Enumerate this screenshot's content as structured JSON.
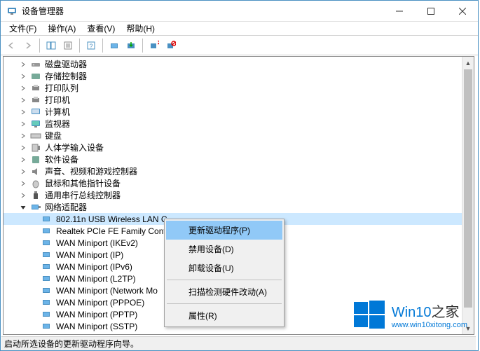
{
  "window": {
    "title": "设备管理器"
  },
  "menu": {
    "file": "文件(F)",
    "action": "操作(A)",
    "view": "查看(V)",
    "help": "帮助(H)"
  },
  "tree": {
    "disk_drives": "磁盘驱动器",
    "storage_controllers": "存储控制器",
    "print_queues": "打印队列",
    "printers": "打印机",
    "computer": "计算机",
    "monitors": "监视器",
    "keyboards": "键盘",
    "hid": "人体学输入设备",
    "software_devices": "软件设备",
    "sound": "声音、视频和游戏控制器",
    "mice": "鼠标和其他指针设备",
    "usb_controllers": "通用串行总线控制器",
    "network_adapters": "网络适配器",
    "na": {
      "n0": "802.11n USB Wireless LAN C",
      "n1": "Realtek PCIe FE Family Contr",
      "n2": "WAN Miniport (IKEv2)",
      "n3": "WAN Miniport (IP)",
      "n4": "WAN Miniport (IPv6)",
      "n5": "WAN Miniport (L2TP)",
      "n6": "WAN Miniport (Network Mo",
      "n7": "WAN Miniport (PPPOE)",
      "n8": "WAN Miniport (PPTP)",
      "n9": "WAN Miniport (SSTP)"
    }
  },
  "context": {
    "update": "更新驱动程序(P)",
    "disable": "禁用设备(D)",
    "uninstall": "卸载设备(U)",
    "scan": "扫描检测硬件改动(A)",
    "properties": "属性(R)"
  },
  "status": "启动所选设备的更新驱动程序向导。",
  "watermark": {
    "brand_a": "Win10",
    "brand_b": "之家",
    "url": "www.win10xitong.com"
  }
}
